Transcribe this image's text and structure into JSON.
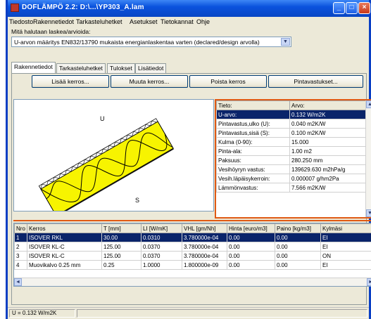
{
  "window": {
    "title": "DOFLÄMPÖ 2.2: D:\\...\\YP303_A.lam",
    "minimize_label": "_",
    "maximize_label": "□",
    "close_label": "×"
  },
  "menu": [
    "Tiedosto",
    "Rakennetiedot",
    "Tarkasteluhetket",
    "Asetukset",
    "Tietokannat",
    "Ohje"
  ],
  "calc_prompt": "Mitä halutaan laskea/arvioida:",
  "calc_select": {
    "value": "U-arvon määritys EN832/13790 mukaista energianlaskentaa varten (declared/design arvolla)",
    "arrow": "▼"
  },
  "tabs": [
    {
      "label": "Rakennetiedot",
      "active": true
    },
    {
      "label": "Tarkasteluhetket",
      "active": false
    },
    {
      "label": "Tulokset",
      "active": false
    },
    {
      "label": "Lisätiedot",
      "active": false
    }
  ],
  "actions": {
    "add": "Lisää kerros...",
    "modify": "Muuta kerros...",
    "delete": "Poista kerros",
    "surface": "Pintavastukset..."
  },
  "diagram": {
    "label_top": "U",
    "label_bottom": "S",
    "fill_color": "#f7f400",
    "stroke_color": "#000000"
  },
  "properties": {
    "headers": [
      "Tieto:",
      "Arvo:"
    ],
    "rows": [
      {
        "name": "U-arvo:",
        "value": "0.132 W/m2K",
        "selected": true
      },
      {
        "name": "Pintavastus,ulko (U):",
        "value": "0.040 m2K/W"
      },
      {
        "name": "Pintavastus,sisä (S):",
        "value": "0.100 m2K/W"
      },
      {
        "name": "Kulma (0-90):",
        "value": "15.000"
      },
      {
        "name": "Pinta-ala:",
        "value": "1.00 m2"
      },
      {
        "name": "Paksuus:",
        "value": "280.250 mm"
      },
      {
        "name": "Vesihöyryn vastus:",
        "value": "139629.630 m2hPa/g"
      },
      {
        "name": "Vesih.läpäisykerroin:",
        "value": "0.000007 g/hm2Pa"
      },
      {
        "name": "Lämmönvastus:",
        "value": "7.566 m2K/W"
      }
    ]
  },
  "layers": {
    "headers": [
      "Nro",
      "Kerros",
      "T [mm]",
      "LI [W/mK]",
      "VHL [gm/Nh]",
      "Hinta [euro/m3]",
      "Paino [kg/m3]",
      "Kylmäsi"
    ],
    "rows": [
      {
        "nro": "1",
        "kerros": "ISOVER RKL",
        "t": "30.00",
        "li": "0.0310",
        "vhl": "3.780000e-04",
        "hinta": "0.00",
        "paino": "0.00",
        "kylma": "EI",
        "selected": true
      },
      {
        "nro": "2",
        "kerros": "ISOVER KL-C",
        "t": "125.00",
        "li": "0.0370",
        "vhl": "3.780000e-04",
        "hinta": "0.00",
        "paino": "0.00",
        "kylma": "EI"
      },
      {
        "nro": "3",
        "kerros": "ISOVER KL-C",
        "t": "125.00",
        "li": "0.0370",
        "vhl": "3.780000e-04",
        "hinta": "0.00",
        "paino": "0.00",
        "kylma": "ON"
      },
      {
        "nro": "4",
        "kerros": "Muovikalvo 0.25 mm",
        "t": "0.25",
        "li": "1.0000",
        "vhl": "1.800000e-09",
        "hinta": "0.00",
        "paino": "0.00",
        "kylma": "EI"
      }
    ]
  },
  "scroll": {
    "up": "▲",
    "down": "▼",
    "left": "◄",
    "right": "►"
  },
  "status": "U = 0.132 W/m2K",
  "colors": {
    "accent_orange": "#e05a14",
    "selection": "#0a246a",
    "titlebar": "#0a52dd"
  }
}
